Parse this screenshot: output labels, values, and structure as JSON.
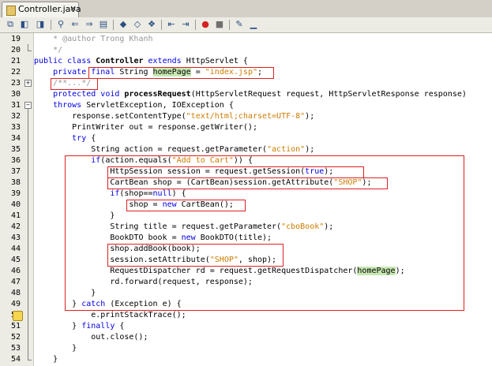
{
  "tab": {
    "label": "Controller.java",
    "close": "×"
  },
  "toolbar": {
    "icons": [
      "editor-icon",
      "back-icon",
      "forward-icon",
      "find-icon",
      "find-prev-icon",
      "find-next-icon",
      "toggle-highlight-icon",
      "prev-bookmark-icon",
      "next-bookmark-icon",
      "toggle-bookmark-icon",
      "shift-left-icon",
      "shift-right-icon",
      "record-macro-icon",
      "stop-macro-icon",
      "comment-icon",
      "uncomment-icon"
    ]
  },
  "lines": [
    {
      "n": "19",
      "fold": "",
      "segs": [
        [
          "    * @author Trong Khanh",
          "cm"
        ]
      ]
    },
    {
      "n": "20",
      "fold": "end",
      "segs": [
        [
          "    */",
          "cm"
        ]
      ]
    },
    {
      "n": "21",
      "fold": "",
      "segs": [
        [
          "public class ",
          "kw"
        ],
        [
          "Controller ",
          "b"
        ],
        [
          "extends ",
          "kw"
        ],
        [
          "HttpServlet {",
          ""
        ]
      ]
    },
    {
      "n": "22",
      "fold": "",
      "segs": [
        [
          "    private ",
          "kw"
        ],
        [
          "final ",
          "kw"
        ],
        [
          "String ",
          ""
        ],
        [
          "homePage",
          "g"
        ],
        [
          " = ",
          ""
        ],
        [
          "\"index.jsp\"",
          "str"
        ],
        [
          ";",
          ""
        ]
      ]
    },
    {
      "n": "23",
      "fold": "plus",
      "segs": [
        [
          "    /**...*/",
          "cm"
        ]
      ]
    },
    {
      "n": "30",
      "fold": "",
      "segs": [
        [
          "    protected ",
          "kw"
        ],
        [
          "void ",
          "kw"
        ],
        [
          "processRequest",
          "b"
        ],
        [
          "(HttpServletRequest request, HttpServletResponse response)",
          ""
        ]
      ]
    },
    {
      "n": "31",
      "fold": "minus",
      "segs": [
        [
          "    throws ",
          "kw"
        ],
        [
          "ServletException, IOException {",
          ""
        ]
      ]
    },
    {
      "n": "32",
      "fold": "",
      "segs": [
        [
          "        response.setContentType(",
          ""
        ],
        [
          "\"text/html;charset=UTF-8\"",
          "str"
        ],
        [
          ");",
          ""
        ]
      ]
    },
    {
      "n": "33",
      "fold": "",
      "segs": [
        [
          "        PrintWriter out = response.getWriter();",
          ""
        ]
      ]
    },
    {
      "n": "34",
      "fold": "",
      "segs": [
        [
          "        try ",
          "kw"
        ],
        [
          "{",
          ""
        ]
      ]
    },
    {
      "n": "35",
      "fold": "",
      "segs": [
        [
          "            String action = request.getParameter(",
          ""
        ],
        [
          "\"action\"",
          "str"
        ],
        [
          ");",
          ""
        ]
      ]
    },
    {
      "n": "36",
      "fold": "",
      "segs": [
        [
          "            if",
          "kw"
        ],
        [
          "(action.equals(",
          ""
        ],
        [
          "\"Add to Cart\"",
          "str"
        ],
        [
          ")) {",
          ""
        ]
      ]
    },
    {
      "n": "37",
      "fold": "",
      "segs": [
        [
          "                HttpSession session = request.getSession(",
          ""
        ],
        [
          "true",
          "kw"
        ],
        [
          ");",
          ""
        ]
      ]
    },
    {
      "n": "38",
      "fold": "",
      "segs": [
        [
          "                CartBean shop = (CartBean)session.getAttribute(",
          ""
        ],
        [
          "\"SHOP\"",
          "str"
        ],
        [
          ");",
          ""
        ]
      ]
    },
    {
      "n": "39",
      "fold": "",
      "segs": [
        [
          "                if",
          "kw"
        ],
        [
          "(shop==",
          ""
        ],
        [
          "null",
          "kw"
        ],
        [
          ") {",
          ""
        ]
      ]
    },
    {
      "n": "40",
      "fold": "",
      "segs": [
        [
          "                    shop = ",
          ""
        ],
        [
          "new ",
          "kw"
        ],
        [
          "CartBean();",
          ""
        ]
      ]
    },
    {
      "n": "41",
      "fold": "",
      "segs": [
        [
          "                }",
          ""
        ]
      ]
    },
    {
      "n": "42",
      "fold": "",
      "segs": [
        [
          "                String title = request.getParameter(",
          ""
        ],
        [
          "\"cboBook\"",
          "str"
        ],
        [
          ");",
          ""
        ]
      ]
    },
    {
      "n": "43",
      "fold": "",
      "segs": [
        [
          "                BookDTO book = ",
          ""
        ],
        [
          "new ",
          "kw"
        ],
        [
          "BookDTO(title);",
          ""
        ]
      ]
    },
    {
      "n": "44",
      "fold": "",
      "segs": [
        [
          "                shop.addBook(book);",
          ""
        ]
      ]
    },
    {
      "n": "45",
      "fold": "",
      "segs": [
        [
          "                session.setAttribute(",
          ""
        ],
        [
          "\"SHOP\"",
          "str"
        ],
        [
          ", shop);",
          ""
        ]
      ]
    },
    {
      "n": "46",
      "fold": "",
      "segs": [
        [
          "                RequestDispatcher rd = request.getRequestDispatcher(",
          ""
        ],
        [
          "homePage",
          "g"
        ],
        [
          ");",
          ""
        ]
      ]
    },
    {
      "n": "47",
      "fold": "",
      "segs": [
        [
          "                rd.forward(request, response);",
          ""
        ]
      ]
    },
    {
      "n": "48",
      "fold": "",
      "segs": [
        [
          "            }",
          ""
        ]
      ]
    },
    {
      "n": "49",
      "fold": "",
      "segs": [
        [
          "        } ",
          ""
        ],
        [
          "catch ",
          "kw"
        ],
        [
          "(Exception e) {",
          ""
        ]
      ]
    },
    {
      "n": "50",
      "fold": "",
      "warn": true,
      "segs": [
        [
          "            e.printStackTrace();",
          ""
        ]
      ]
    },
    {
      "n": "51",
      "fold": "",
      "segs": [
        [
          "        } ",
          ""
        ],
        [
          "finally ",
          "kw"
        ],
        [
          "{",
          ""
        ]
      ]
    },
    {
      "n": "52",
      "fold": "",
      "segs": [
        [
          "            out.close();",
          ""
        ]
      ]
    },
    {
      "n": "53",
      "fold": "",
      "segs": [
        [
          "        }",
          ""
        ]
      ]
    },
    {
      "n": "54",
      "fold": "end",
      "segs": [
        [
          "    }",
          ""
        ]
      ]
    }
  ],
  "colors": {
    "keyword": "#0000e6",
    "string": "#ce7b00",
    "comment": "#969696",
    "highlight": "#c7e8b1",
    "annotation_box": "#e02020"
  }
}
